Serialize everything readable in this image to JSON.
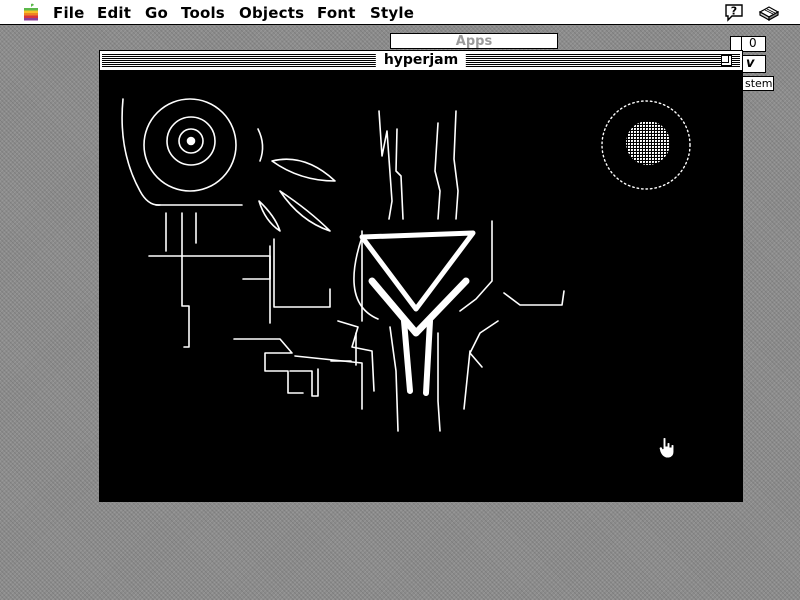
{
  "menubar": {
    "items": [
      "File",
      "Edit",
      "Go",
      "Tools",
      "Objects",
      "Font",
      "Style"
    ],
    "help_icon": "help-icon",
    "app_icon": "hypercard-stack-icon"
  },
  "background_windows": {
    "apps_title": "Apps",
    "box_value": "0",
    "checkmark": "v",
    "partial_label": "stem"
  },
  "window": {
    "title": "hyperjam",
    "zoom_icon": "zoom-box-icon"
  },
  "canvas": {
    "background": "#000000",
    "stroke": "#ffffff"
  }
}
